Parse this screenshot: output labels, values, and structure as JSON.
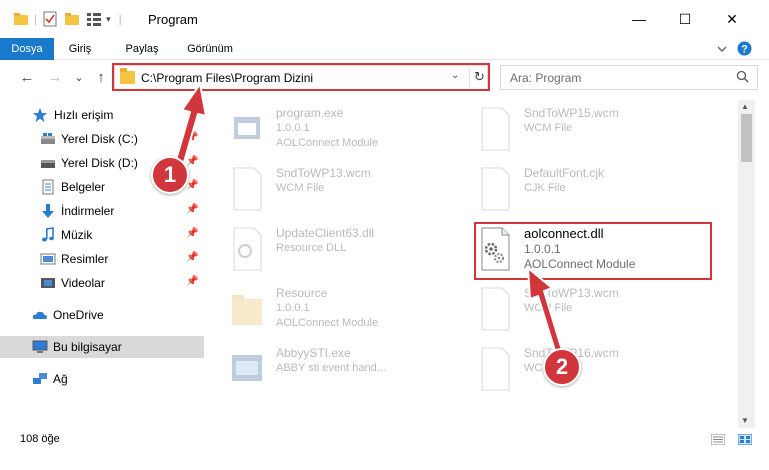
{
  "window": {
    "title": "Program",
    "controls": {
      "minimize": "—",
      "maximize": "☐",
      "close": "✕"
    }
  },
  "ribbon": {
    "tabs": [
      {
        "label": "Dosya",
        "active": true
      },
      {
        "label": "Giriş",
        "active": false
      },
      {
        "label": "Paylaş",
        "active": false
      },
      {
        "label": "Görünüm",
        "active": false
      }
    ],
    "expand_icon": "chevron-down-icon",
    "help_icon": "help-icon"
  },
  "nav": {
    "back_icon": "←",
    "forward_icon": "→",
    "recent_icon": "⌄",
    "up_icon": "↑",
    "address": "C:\\Program Files\\Program Dizini",
    "search_placeholder": "Ara: Program"
  },
  "sidebar": {
    "items": [
      {
        "label": "Hızlı erişim",
        "icon": "star-icon",
        "pinned": false
      },
      {
        "label": "Yerel Disk (C:)",
        "icon": "drive-icon",
        "pinned": true
      },
      {
        "label": "Yerel Disk (D:)",
        "icon": "drive-icon",
        "pinned": true
      },
      {
        "label": "Belgeler",
        "icon": "documents-icon",
        "pinned": true
      },
      {
        "label": "İndirmeler",
        "icon": "download-icon",
        "pinned": true
      },
      {
        "label": "Müzik",
        "icon": "music-icon",
        "pinned": true
      },
      {
        "label": "Resimler",
        "icon": "pictures-icon",
        "pinned": true
      },
      {
        "label": "Videolar",
        "icon": "videos-icon",
        "pinned": true
      },
      {
        "label": "OneDrive",
        "icon": "cloud-icon",
        "pinned": false
      },
      {
        "label": "Bu bilgisayar",
        "icon": "computer-icon",
        "pinned": false,
        "selected": true
      },
      {
        "label": "Ağ",
        "icon": "network-icon",
        "pinned": false
      }
    ],
    "pin_glyph": "📌"
  },
  "files": [
    {
      "name": "program.exe",
      "line1": "1.0.0.1",
      "line2": "AOLConnect Module",
      "icon": "exe-icon",
      "faded": true
    },
    {
      "name": "SndToWP15.wcm",
      "line1": "WCM File",
      "line2": "",
      "icon": "file-icon",
      "faded": true
    },
    {
      "name": "SndToWP13.wcm",
      "line1": "WCM File",
      "line2": "",
      "icon": "file-icon",
      "faded": true
    },
    {
      "name": "DefaultFont.cjk",
      "line1": "CJK File",
      "line2": "",
      "icon": "file-icon",
      "faded": true
    },
    {
      "name": "UpdateClient63.dll",
      "line1": "Resource DLL",
      "line2": "",
      "icon": "dll-icon",
      "faded": true
    },
    {
      "name": "aolconnect.dll",
      "line1": "1.0.0.1",
      "line2": "AOLConnect Module",
      "icon": "dll-icon",
      "faded": false
    },
    {
      "name": "Resource",
      "line1": "1.0.0.1",
      "line2": "AOLConnect Module",
      "icon": "folder-icon",
      "faded": true
    },
    {
      "name": "SndToWP13.wcm",
      "line1": "WCM File",
      "line2": "",
      "icon": "file-icon",
      "faded": true
    },
    {
      "name": "AbbyySTI.exe",
      "line1": "ABBY sti event hand...",
      "line2": "",
      "icon": "exe-icon",
      "faded": true
    },
    {
      "name": "SndToWP16.wcm",
      "line1": "WCM File",
      "line2": "",
      "icon": "file-icon",
      "faded": true
    }
  ],
  "status": {
    "item_count": "108 öğe"
  },
  "annotations": {
    "marker1": "1",
    "marker2": "2"
  },
  "colors": {
    "accent": "#1979ca",
    "highlight": "#d0363b",
    "selected_bg": "#d9d9d9"
  }
}
